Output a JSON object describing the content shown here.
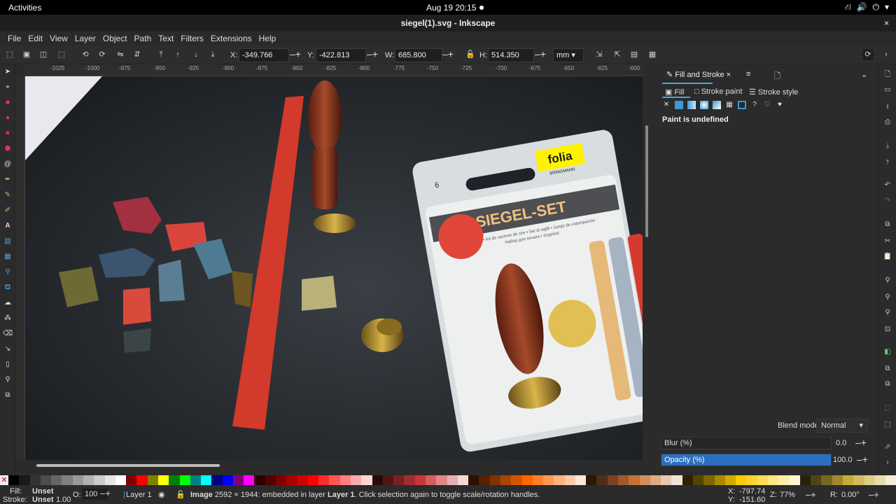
{
  "system": {
    "activities": "Activities",
    "clock": "Aug 19  20:15"
  },
  "window": {
    "title": "siegel(1).svg - Inkscape",
    "close": "×"
  },
  "menu": [
    "File",
    "Edit",
    "View",
    "Layer",
    "Object",
    "Path",
    "Text",
    "Filters",
    "Extensions",
    "Help"
  ],
  "toolbar": {
    "x_label": "X:",
    "x_value": "-349.766",
    "y_label": "Y:",
    "y_value": "-422.813",
    "w_label": "W:",
    "w_value": "685.800",
    "h_label": "H:",
    "h_value": "514.350",
    "unit": "mm"
  },
  "ruler_ticks": [
    "-1025",
    "-1000",
    "-975",
    "-950",
    "-925",
    "-900",
    "-875",
    "-850",
    "-825",
    "-800",
    "-775",
    "-750",
    "-725",
    "-700",
    "-675",
    "-650",
    "-625",
    "-600"
  ],
  "canvas": {
    "box_number": "6",
    "brand": "folia",
    "brand_sub": "BRINGMANN",
    "product": "SIEGEL-SET",
    "subtitle": "Seal set • Kit de cachets de cire • Set di sigilli • Juego de estampación",
    "subtitle2": "Набор для печати • Zegelset"
  },
  "panel": {
    "tab_fill_stroke": "Fill and Stroke",
    "subtab_fill": "Fill",
    "subtab_stroke_paint": "Stroke paint",
    "subtab_stroke_style": "Stroke style",
    "paint_status": "Paint is undefined",
    "blend_label": "Blend mode:",
    "blend_value": "Normal",
    "blur_label": "Blur (%)",
    "blur_value": "0.0",
    "opacity_label": "Opacity (%)",
    "opacity_value": "100.0",
    "opacity_fraction": 1.0
  },
  "palette_colors": [
    "#000000",
    "#1a1a1a",
    "#333333",
    "#4d4d4d",
    "#666666",
    "#808080",
    "#999999",
    "#b3b3b3",
    "#cccccc",
    "#e6e6e6",
    "#ffffff",
    "#800000",
    "#ff0000",
    "#808000",
    "#ffff00",
    "#008000",
    "#00ff00",
    "#008080",
    "#00ffff",
    "#000080",
    "#0000ff",
    "#800080",
    "#ff00ff",
    "#2b0000",
    "#550000",
    "#800000",
    "#aa0000",
    "#d40000",
    "#ff0000",
    "#ff2a2a",
    "#ff5555",
    "#ff8080",
    "#ffaaaa",
    "#ffd5d5",
    "#280b0b",
    "#501616",
    "#782121",
    "#a02c2c",
    "#c83737",
    "#d35f5f",
    "#de8787",
    "#e9afaf",
    "#f4d7d7",
    "#2b1100",
    "#552200",
    "#803300",
    "#aa4400",
    "#d45500",
    "#ff6600",
    "#ff7f2a",
    "#ff9955",
    "#ffb380",
    "#ffccaa",
    "#ffe6d5",
    "#28170b",
    "#502d16",
    "#784421",
    "#a05a2c",
    "#c87137",
    "#d38d5f",
    "#deaa87",
    "#e9c6af",
    "#f4e3d7",
    "#2b2200",
    "#554400",
    "#806600",
    "#aa8800",
    "#d4aa00",
    "#ffcc00",
    "#ffd42a",
    "#ffdd55",
    "#ffe680",
    "#ffeeaa",
    "#fff6d5",
    "#28220b",
    "#504416",
    "#786721",
    "#a0892c",
    "#c8ab37",
    "#d3bc5f",
    "#decd87",
    "#e9ddaf",
    "#f4eed7"
  ],
  "status": {
    "fill_label": "Fill:",
    "fill_value": "Unset",
    "stroke_label": "Stroke:",
    "stroke_value": "Unset",
    "stroke_width": "1.00",
    "opacity_label": "O:",
    "opacity_value": "100",
    "layer": "Layer 1",
    "message_bold": "Image",
    "message": "2592 × 1944: embedded in layer",
    "message_layer": "Layer 1",
    "message_tail": ". Click selection again to toggle scale/rotation handles.",
    "cx_label": "X:",
    "cx": "-797.74",
    "cy_label": "Y:",
    "cy": "-151.60",
    "zoom_label": "Z:",
    "zoom": "77%",
    "rot_label": "R:",
    "rot": "0.00°"
  }
}
